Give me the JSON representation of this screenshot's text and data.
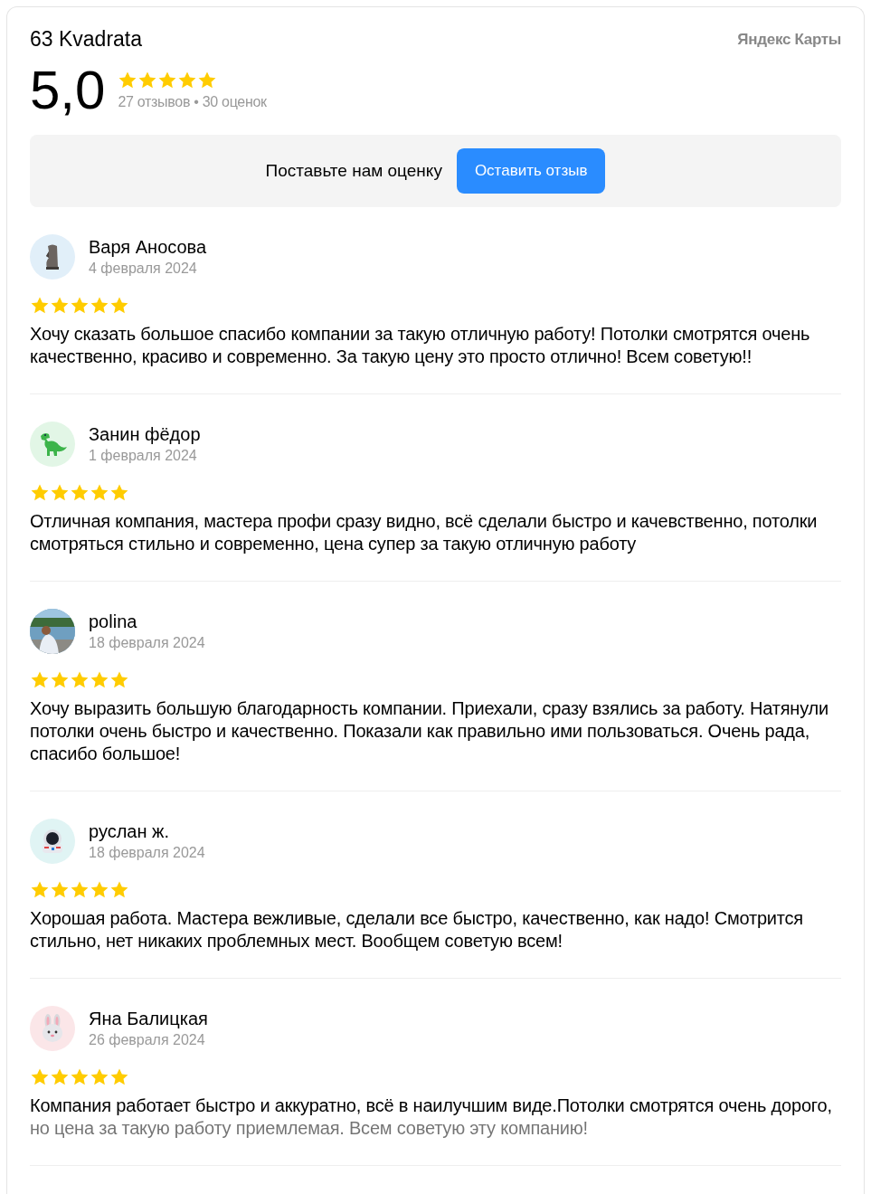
{
  "header": {
    "title": "63 Kvadrata",
    "brand": "Яндекс Карты",
    "rating": "5,0",
    "stars": 5,
    "counts": "27 отзывов • 30 оценок"
  },
  "prompt": {
    "text": "Поставьте нам оценку",
    "button": "Оставить отзыв"
  },
  "reviews": [
    {
      "name": "Варя Аносова",
      "date": "4 февраля 2024",
      "stars": 5,
      "avatar": {
        "kind": "moai",
        "color": "#e1eff9"
      },
      "faded": false,
      "text": "Хочу сказать большое спасибо компании за такую отличную работу! Потолки смотрятся очень качественно, красиво и современно. За такую цену это просто отлично! Всем советую!!"
    },
    {
      "name": "Занин фёдор",
      "date": "1 февраля 2024",
      "stars": 5,
      "avatar": {
        "kind": "dinosaur",
        "color": "#e2f6e6"
      },
      "faded": false,
      "text": "Отличная компания, мастера профи сразу видно, всё сделали быстро и качевственно, потолки смотряться стильно и современно, цена супер за такую отличную работу"
    },
    {
      "name": "polina",
      "date": "18 февраля 2024",
      "stars": 5,
      "faded": false,
      "text": "Хочу выразить большую благодарность компании. Приехали, сразу взялись за работу. Натянули потолки очень быстро и качественно. Показали как правильно ими пользоваться. Очень рада, спасибо большое!"
    },
    {
      "name": "руслан ж.",
      "date": "18 февраля 2024",
      "stars": 5,
      "avatar": {
        "kind": "astronaut",
        "color": "#e0f4f4"
      },
      "faded": false,
      "text": "Хорошая работа. Мастера вежливые, сделали все быстро, качественно, как надо! Смотрится стильно, нет никаких проблемных мест. Вообщем советую всем!"
    },
    {
      "name": "Яна Балицкая",
      "date": "26 февраля 2024",
      "stars": 5,
      "avatar": {
        "kind": "bunny",
        "color": "#fbe6e8"
      },
      "faded": true,
      "text": "Компания работает быстро и аккуратно, всё в наилучшим виде.Потолки смотрятся очень дорого, но цена за такую работу приемлемая. Всем советую эту компанию!"
    }
  ]
}
